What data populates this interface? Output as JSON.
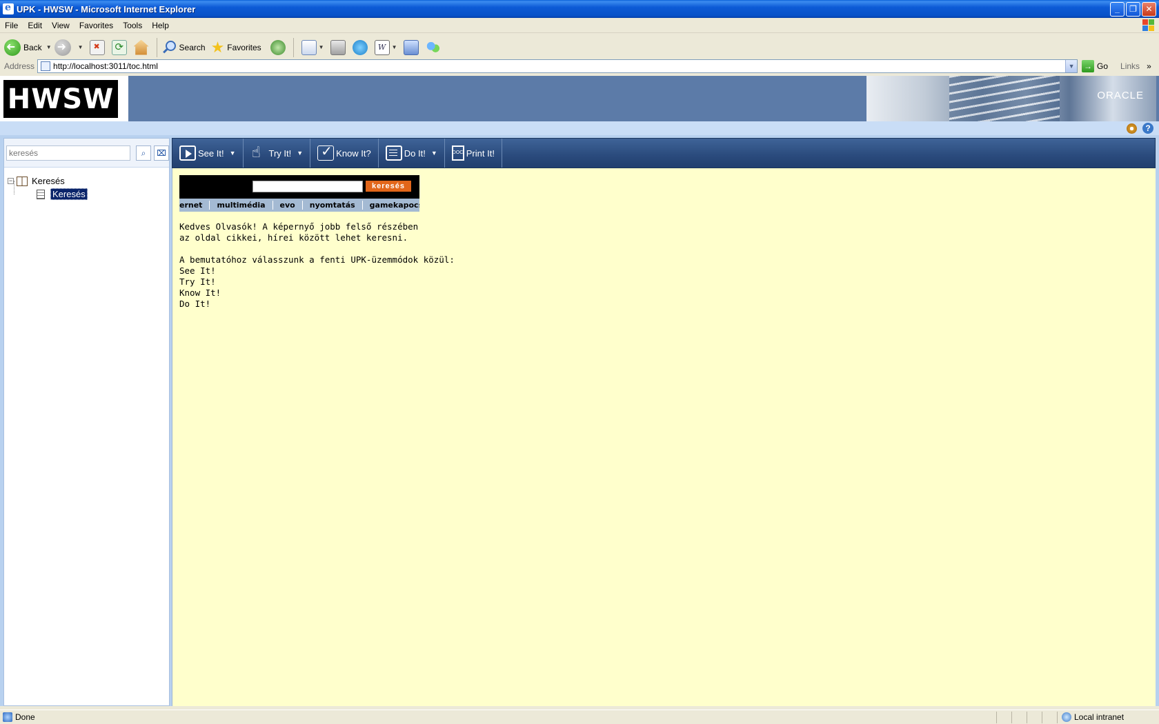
{
  "window": {
    "title": "UPK - HWSW - Microsoft Internet Explorer"
  },
  "menu": [
    "File",
    "Edit",
    "View",
    "Favorites",
    "Tools",
    "Help"
  ],
  "toolbar": {
    "back_label": "Back",
    "search_label": "Search",
    "favorites_label": "Favorites"
  },
  "address": {
    "label": "Address",
    "url": "http://localhost:3011/toc.html",
    "go_label": "Go",
    "links_label": "Links"
  },
  "brand": {
    "logo_text": "HWSW",
    "oracle_text": "ORACLE"
  },
  "sidebar": {
    "search_placeholder": "keresés",
    "tree": {
      "root_label": "Keresés",
      "child_label": "Keresés"
    }
  },
  "modes": [
    {
      "label": "See It!",
      "icon": "play-icon"
    },
    {
      "label": "Try It!",
      "icon": "hand-icon"
    },
    {
      "label": "Know It?",
      "icon": "checklist-icon"
    },
    {
      "label": "Do It!",
      "icon": "do-icon"
    },
    {
      "label": "Print It!",
      "icon": "doc-icon"
    }
  ],
  "content": {
    "site_search_button": "keresés",
    "site_nav": [
      "ernet",
      "multimédia",
      "evo",
      "nyomtatás",
      "gamekapocs"
    ],
    "intro_lines": [
      "Kedves Olvasók! A képernyő jobb felső részében",
      "az oldal cikkei, hírei között lehet keresni.",
      "A bemutatóhoz válasszunk a fenti UPK-üzemmódok közül:",
      "See It!",
      "Try It!",
      "Know It!",
      "Do It!"
    ]
  },
  "status": {
    "text": "Done",
    "zone": "Local intranet"
  }
}
